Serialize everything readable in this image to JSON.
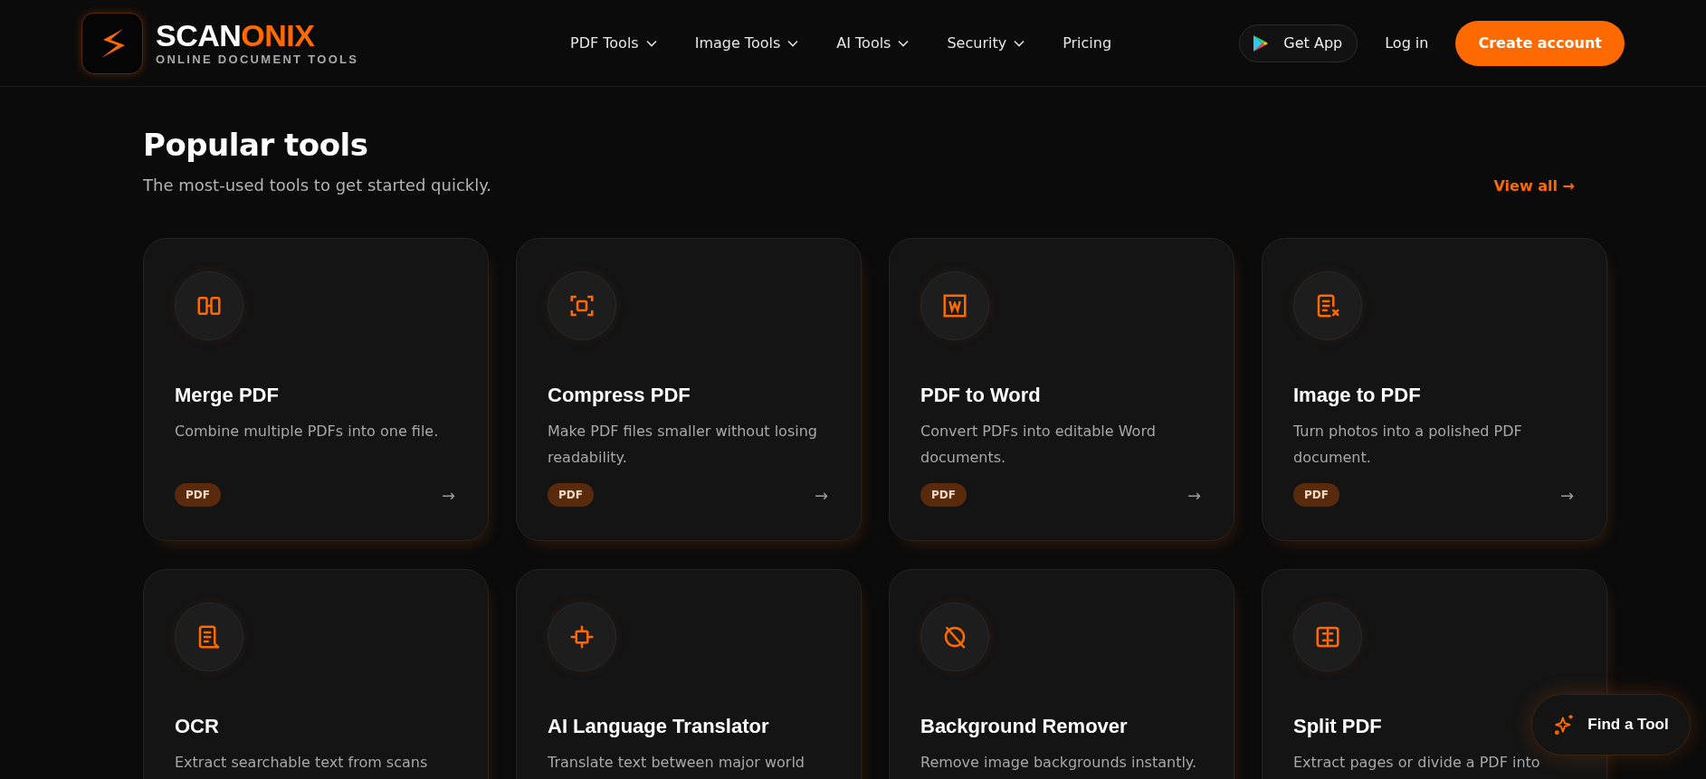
{
  "header": {
    "brand": {
      "name_part_1": "SCAN",
      "name_part_2": "ONIX",
      "tagline": "ONLINE DOCUMENT TOOLS"
    },
    "nav": [
      {
        "label": "PDF Tools",
        "dropdown": true
      },
      {
        "label": "Image Tools",
        "dropdown": true
      },
      {
        "label": "AI Tools",
        "dropdown": true
      },
      {
        "label": "Security",
        "dropdown": true
      },
      {
        "label": "Pricing",
        "dropdown": false
      }
    ],
    "get_app": "Get App",
    "login": "Log in",
    "cta": "Create account"
  },
  "section": {
    "title": "Popular tools",
    "subtitle": "The most-used tools to get started quickly.",
    "view_all": "View all →"
  },
  "tools": [
    {
      "title": "Merge PDF",
      "description": "Combine multiple PDFs into one file.",
      "badge": "PDF",
      "arrow": "→"
    },
    {
      "title": "Compress PDF",
      "description": "Make PDF files smaller without losing readability.",
      "badge": "PDF",
      "arrow": "→"
    },
    {
      "title": "PDF to Word",
      "description": "Convert PDFs into editable Word documents.",
      "badge": "PDF",
      "arrow": "→"
    },
    {
      "title": "Image to PDF",
      "description": "Turn photos into a polished PDF document.",
      "badge": "PDF",
      "arrow": "→"
    },
    {
      "title": "OCR",
      "description": "Extract searchable text from scans"
    },
    {
      "title": "AI Language Translator",
      "description": "Translate text between major world"
    },
    {
      "title": "Background Remover",
      "description": "Remove image backgrounds instantly."
    },
    {
      "title": "Split PDF",
      "description": "Extract pages or divide a PDF into"
    }
  ],
  "find_tool": "Find a Tool"
}
